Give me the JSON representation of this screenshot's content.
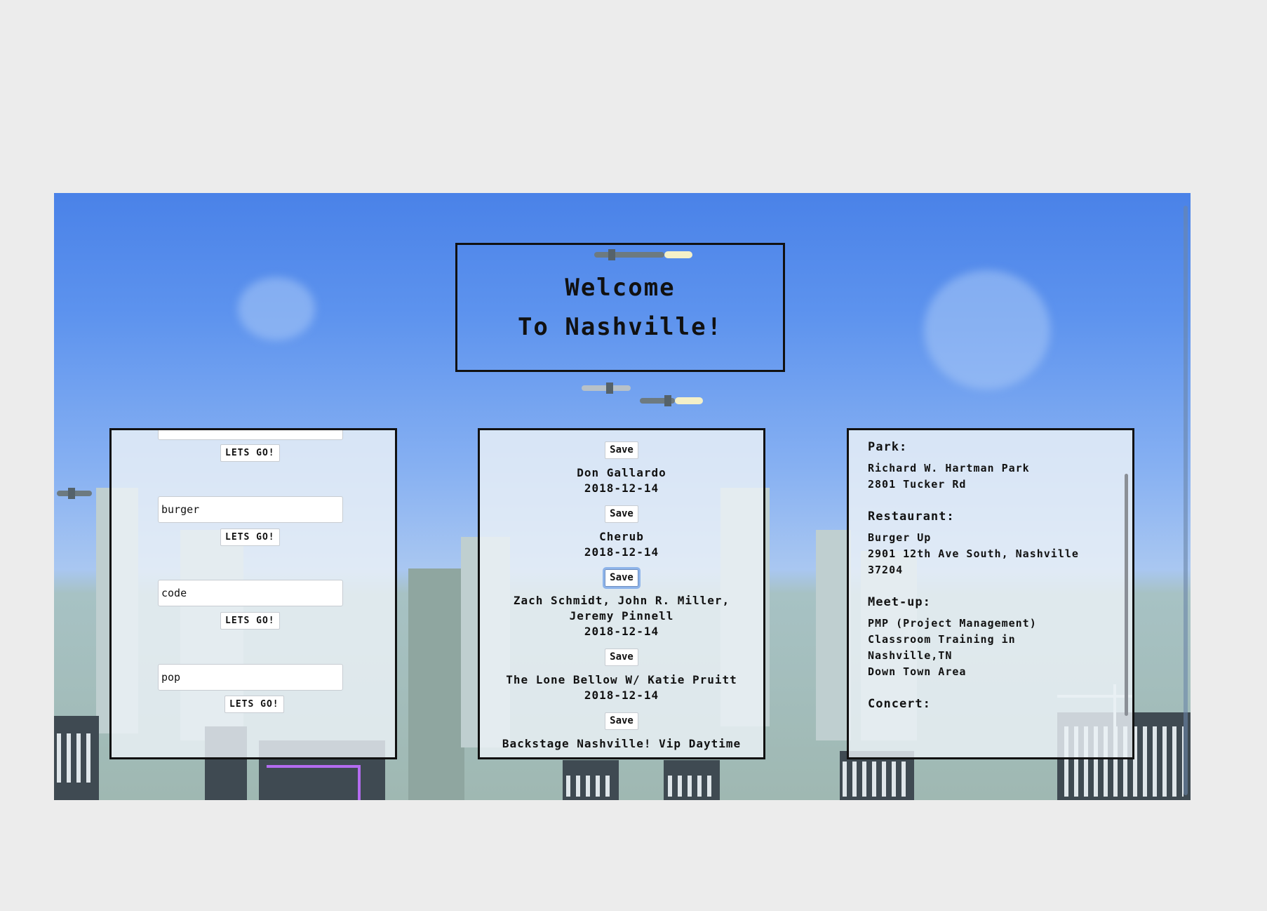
{
  "welcome": {
    "line1": "Welcome",
    "line2": "To Nashville!"
  },
  "search_panel": {
    "button_label": "LETS GO!",
    "queries": [
      {
        "value": ""
      },
      {
        "value": "burger"
      },
      {
        "value": "code"
      },
      {
        "value": "pop"
      }
    ]
  },
  "events_panel": {
    "save_label": "Save",
    "events": [
      {
        "name": "Don Gallardo",
        "date": "2018-12-14"
      },
      {
        "name": "Cherub",
        "date": "2018-12-14"
      },
      {
        "name": "Zach Schmidt, John R. Miller, Jeremy Pinnell",
        "date": "2018-12-14"
      },
      {
        "name": "The Lone Bellow W/ Katie Pruitt",
        "date": "2018-12-14"
      },
      {
        "name": "Backstage Nashville! Vip Daytime",
        "date": ""
      }
    ]
  },
  "saved_panel": {
    "park": {
      "heading": "Park:",
      "lines": [
        "Richard W. Hartman Park",
        "2801 Tucker Rd"
      ]
    },
    "restaurant": {
      "heading": "Restaurant:",
      "lines": [
        "Burger Up",
        "2901 12th Ave South, Nashville",
        "37204"
      ]
    },
    "meetup": {
      "heading": "Meet-up:",
      "lines": [
        "PMP (Project Management)",
        "Classroom Training in",
        "Nashville,TN",
        "Down Town Area"
      ]
    },
    "concert": {
      "heading": "Concert:"
    }
  }
}
